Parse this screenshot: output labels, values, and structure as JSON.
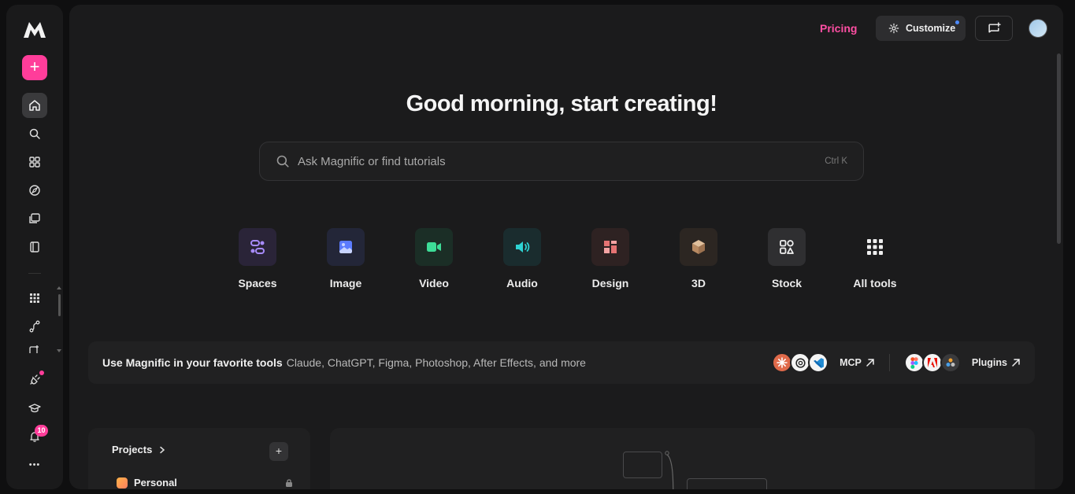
{
  "sidebar": {
    "new_label": "+",
    "notifications_count": "10",
    "more_label": "•••"
  },
  "topbar": {
    "pricing_label": "Pricing",
    "customize_label": "Customize"
  },
  "hero": {
    "greeting": "Good morning, start creating!"
  },
  "search": {
    "placeholder": "Ask Magnific or find tutorials",
    "shortcut": "Ctrl K"
  },
  "tools": [
    {
      "label": "Spaces",
      "color": "#a78bfa",
      "bg": "#2a2438"
    },
    {
      "label": "Image",
      "color": "#7b9cff",
      "bg": "#232638"
    },
    {
      "label": "Video",
      "color": "#3ddc97",
      "bg": "#1b2e26"
    },
    {
      "label": "Audio",
      "color": "#2ed3d3",
      "bg": "#1a2c2e"
    },
    {
      "label": "Design",
      "color": "#f08a8a",
      "bg": "#2e2222"
    },
    {
      "label": "3D",
      "color": "#c9a07a",
      "bg": "#2c2622"
    },
    {
      "label": "Stock",
      "color": "#e8e8e8",
      "bg": "#2f2f31"
    },
    {
      "label": "All tools",
      "color": "#e8e8e8",
      "bg": "transparent"
    }
  ],
  "banner": {
    "title": "Use Magnific in your favorite tools",
    "subtitle": "Claude, ChatGPT, Figma, Photoshop, After Effects, and more",
    "mcp_label": "MCP",
    "plugins_label": "Plugins"
  },
  "projects": {
    "title": "Projects",
    "add_label": "+",
    "items": [
      {
        "label": "Personal"
      }
    ]
  }
}
